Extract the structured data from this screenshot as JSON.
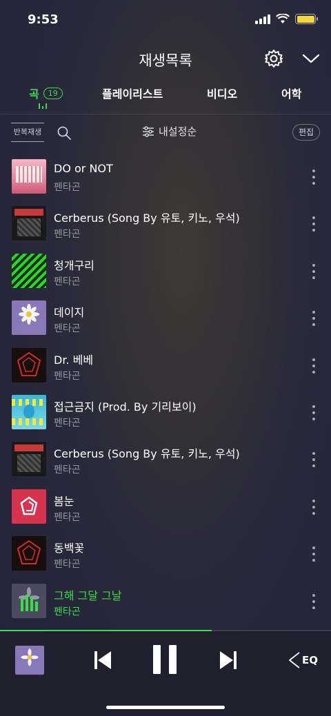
{
  "status_bar": {
    "time": "9:53",
    "battery_color": "#f5d63d"
  },
  "header": {
    "title": "재생목록",
    "settings_icon": "gear-icon",
    "collapse_icon": "chevron-down-icon"
  },
  "tabs": [
    {
      "label": "곡",
      "badge": "19",
      "active": true
    },
    {
      "label": "플레이리스트"
    },
    {
      "label": "비디오"
    },
    {
      "label": "어학"
    }
  ],
  "toolbar": {
    "repeat_label": "반복재생",
    "sort_label": "내설정순",
    "edit_label": "편집"
  },
  "songs": [
    {
      "title": "DO or NOT",
      "artist": "펜타곤"
    },
    {
      "title": "Cerberus (Song By 유토, 키노, 우석)",
      "artist": "펜타곤"
    },
    {
      "title": "청개구리",
      "artist": "펜타곤"
    },
    {
      "title": "데이지",
      "artist": "펜타곤"
    },
    {
      "title": "Dr. 베베",
      "artist": "펜타곤"
    },
    {
      "title": "접근금지 (Prod. By 기리보이)",
      "artist": "펜타곤"
    },
    {
      "title": "Cerberus (Song By 유토, 키노, 우석)",
      "artist": "펜타곤"
    },
    {
      "title": "봄눈",
      "artist": "펜타곤"
    },
    {
      "title": "동백꽃",
      "artist": "펜타곤"
    },
    {
      "title": "그해 그달 그날",
      "artist": "펜타곤",
      "active": true
    }
  ],
  "player": {
    "progress": 0.64,
    "eq_label": "EQ"
  },
  "colors": {
    "accent": "#3ddc4a"
  }
}
